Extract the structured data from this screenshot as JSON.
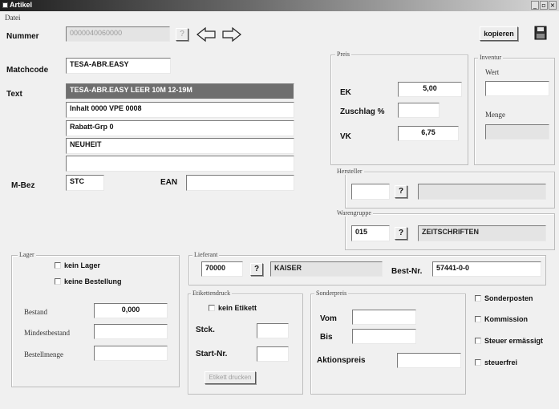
{
  "window": {
    "title": "Artikel",
    "minimize_glyph": "_",
    "restore_glyph": "▫",
    "close_glyph": "×"
  },
  "menu": {
    "file": "Datei"
  },
  "header": {
    "nummer_label": "Nummer",
    "nummer_value": "0000040060000",
    "question_glyph": "?",
    "kopieren_label": "kopieren"
  },
  "article": {
    "matchcode_label": "Matchcode",
    "matchcode_value": "TESA-ABR.EASY",
    "text_label": "Text",
    "text_lines": [
      "TESA-ABR.EASY LEER 10M 12-19M",
      "Inhalt 0000 VPE 0008",
      "Rabatt-Grp 0",
      "NEUHEIT",
      ""
    ],
    "mbez_label": "M-Bez",
    "mbez_value": "STC",
    "ean_label": "EAN",
    "ean_value": ""
  },
  "preis": {
    "title": "Preis",
    "ek_label": "EK",
    "ek_value": "5,00",
    "zuschlag_label": "Zuschlag %",
    "zuschlag_value": "",
    "vk_label": "VK",
    "vk_value": "6,75"
  },
  "inventur": {
    "title": "Inventur",
    "wert_label": "Wert",
    "wert_value": "",
    "menge_label": "Menge",
    "menge_value": ""
  },
  "hersteller": {
    "title": "Hersteller",
    "code": "",
    "name": ""
  },
  "warengruppe": {
    "title": "Warengruppe",
    "code": "015",
    "name": "ZEITSCHRIFTEN"
  },
  "lager": {
    "title": "Lager",
    "kein_lager_label": "kein Lager",
    "keine_bestellung_label": "keine Bestellung",
    "bestand_label": "Bestand",
    "bestand_value": "0,000",
    "mindestbestand_label": "Mindestbestand",
    "mindestbestand_value": "",
    "bestellmenge_label": "Bestellmenge",
    "bestellmenge_value": ""
  },
  "lieferant": {
    "title": "Lieferant",
    "code": "70000",
    "name": "KAISER",
    "bestnr_label": "Best-Nr.",
    "bestnr_value": "57441-0-0"
  },
  "etikettendruck": {
    "title": "Etikettendruck",
    "kein_etikett_label": "kein Etikett",
    "stck_label": "Stck.",
    "stck_value": "",
    "startnr_label": "Start-Nr.",
    "startnr_value": "",
    "drucken_label": "Etikett drucken"
  },
  "sonderpreis": {
    "title": "Sonderpreis",
    "vom_label": "Vom",
    "vom_value": "",
    "bis_label": "Bis",
    "bis_value": "",
    "aktionspreis_label": "Aktionspreis",
    "aktionspreis_value": ""
  },
  "flags": {
    "sonderposten_label": "Sonderposten",
    "kommission_label": "Kommission",
    "steuer_label": "Steuer ermässigt",
    "steuerfrei_label": "steuerfrei"
  }
}
